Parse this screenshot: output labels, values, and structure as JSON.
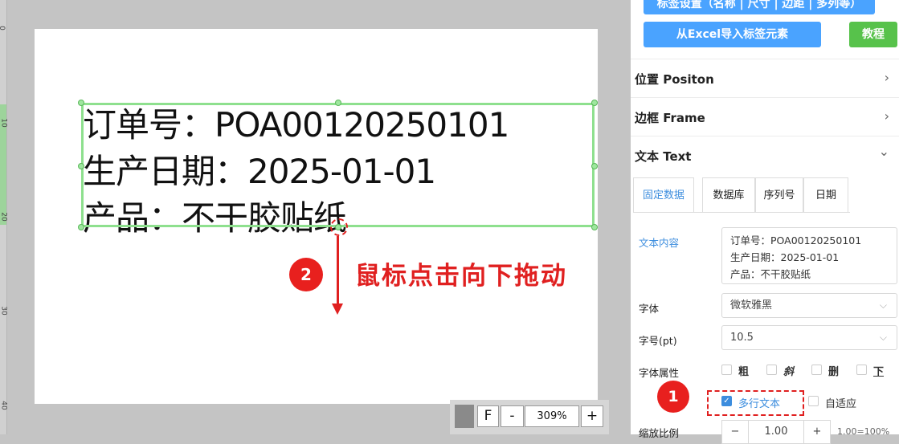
{
  "ruler": {
    "marks": [
      "0",
      "10",
      "20",
      "30",
      "40"
    ]
  },
  "label": {
    "lines": [
      "订单号：POA00120250101",
      "生产日期：2025-01-01",
      "产品：不干胶贴纸"
    ]
  },
  "annotations": {
    "step2_number": "2",
    "step2_text": "鼠标点击向下拖动",
    "step1_number": "1"
  },
  "zoom_bar": {
    "fit_label": "F",
    "minus_label": "-",
    "zoom_value": "309%",
    "plus_label": "+"
  },
  "panel": {
    "top_button": "标签设置（名称 | 尺寸 | 边距 | 多列等）",
    "import_button": "从Excel导入标签元素",
    "tutorial_button": "教程",
    "sections": [
      {
        "title": "位置 Positon",
        "chevron": "›"
      },
      {
        "title": "边框 Frame",
        "chevron": "›"
      },
      {
        "title": "文本 Text",
        "chevron": "⌄"
      }
    ],
    "tabs": [
      {
        "label": "固定数据",
        "active": true
      },
      {
        "label": "数据库",
        "active": false
      },
      {
        "label": "序列号",
        "active": false
      },
      {
        "label": "日期",
        "active": false
      }
    ],
    "text_content_label": "文本内容",
    "text_content_value": "订单号：POA00120250101\n生产日期：2025-01-01\n产品：不干胶贴纸",
    "font_label": "字体",
    "font_value": "微软雅黑",
    "size_label": "字号(pt)",
    "size_value": "10.5",
    "style_label": "字体属性",
    "style_options": [
      "粗",
      "斜",
      "删",
      "下"
    ],
    "multiline_label": "多行文本",
    "multiline_checked": true,
    "autofit_label": "自适应",
    "scale_label": "缩放比例",
    "scale_minus": "−",
    "scale_value": "1.00",
    "scale_plus": "+",
    "scale_hint": "1.00=100%"
  },
  "colors": {
    "accent_blue": "#4aa3ff",
    "accent_green": "#57c24b",
    "selection_green": "#8ee08e",
    "annotation_red": "#e02020"
  }
}
